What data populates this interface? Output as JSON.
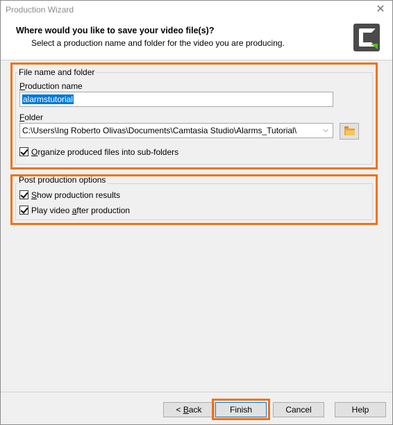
{
  "window": {
    "title": "Production Wizard",
    "close_glyph": "✕"
  },
  "header": {
    "title": "Where would you like to save your video file(s)?",
    "subtitle": "Select a production name and folder for the video you are producing.",
    "logo_icon": "camtasia-logo-icon"
  },
  "file_group": {
    "legend": "File name and folder",
    "production_name_label_ul": "P",
    "production_name_label_rest": "roduction name",
    "production_name_value": "alarmstutorial",
    "folder_label_ul": "F",
    "folder_label_rest": "older",
    "folder_value": "C:\\Users\\Ing Roberto Olivas\\Documents\\Camtasia Studio\\Alarms_Tutorial\\",
    "organize_ul": "O",
    "organize_rest": "rganize produced files into sub-folders",
    "organize_checked": true
  },
  "post_group": {
    "legend": "Post production options",
    "show_results_ul": "S",
    "show_results_rest": "how production results",
    "show_results_checked": true,
    "play_video_pre": "Play video ",
    "play_video_ul": "a",
    "play_video_rest": "fter production",
    "play_video_checked": true
  },
  "buttons": {
    "back_pre": "< ",
    "back_ul": "B",
    "back_rest": "ack",
    "finish": "Finish",
    "cancel": "Cancel",
    "help": "Help"
  },
  "colors": {
    "highlight": "#f07217",
    "selection": "#0078d7"
  }
}
